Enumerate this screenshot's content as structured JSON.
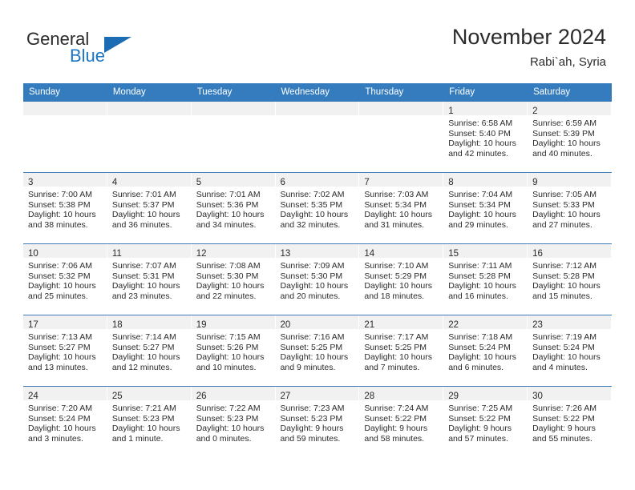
{
  "brand": {
    "name_top": "General",
    "name_bottom": "Blue",
    "accent_color": "#1b6cb3"
  },
  "header": {
    "title": "November 2024",
    "subtitle": "Rabi`ah, Syria"
  },
  "theme": {
    "header_bg": "#357cbf",
    "daynum_bg": "#f1f1f1",
    "row_border": "#3f7cb8"
  },
  "weekdays": [
    "Sunday",
    "Monday",
    "Tuesday",
    "Wednesday",
    "Thursday",
    "Friday",
    "Saturday"
  ],
  "weeks": [
    [
      {
        "day": "",
        "lines": []
      },
      {
        "day": "",
        "lines": []
      },
      {
        "day": "",
        "lines": []
      },
      {
        "day": "",
        "lines": []
      },
      {
        "day": "",
        "lines": []
      },
      {
        "day": "1",
        "lines": [
          "Sunrise: 6:58 AM",
          "Sunset: 5:40 PM",
          "Daylight: 10 hours",
          "and 42 minutes."
        ]
      },
      {
        "day": "2",
        "lines": [
          "Sunrise: 6:59 AM",
          "Sunset: 5:39 PM",
          "Daylight: 10 hours",
          "and 40 minutes."
        ]
      }
    ],
    [
      {
        "day": "3",
        "lines": [
          "Sunrise: 7:00 AM",
          "Sunset: 5:38 PM",
          "Daylight: 10 hours",
          "and 38 minutes."
        ]
      },
      {
        "day": "4",
        "lines": [
          "Sunrise: 7:01 AM",
          "Sunset: 5:37 PM",
          "Daylight: 10 hours",
          "and 36 minutes."
        ]
      },
      {
        "day": "5",
        "lines": [
          "Sunrise: 7:01 AM",
          "Sunset: 5:36 PM",
          "Daylight: 10 hours",
          "and 34 minutes."
        ]
      },
      {
        "day": "6",
        "lines": [
          "Sunrise: 7:02 AM",
          "Sunset: 5:35 PM",
          "Daylight: 10 hours",
          "and 32 minutes."
        ]
      },
      {
        "day": "7",
        "lines": [
          "Sunrise: 7:03 AM",
          "Sunset: 5:34 PM",
          "Daylight: 10 hours",
          "and 31 minutes."
        ]
      },
      {
        "day": "8",
        "lines": [
          "Sunrise: 7:04 AM",
          "Sunset: 5:34 PM",
          "Daylight: 10 hours",
          "and 29 minutes."
        ]
      },
      {
        "day": "9",
        "lines": [
          "Sunrise: 7:05 AM",
          "Sunset: 5:33 PM",
          "Daylight: 10 hours",
          "and 27 minutes."
        ]
      }
    ],
    [
      {
        "day": "10",
        "lines": [
          "Sunrise: 7:06 AM",
          "Sunset: 5:32 PM",
          "Daylight: 10 hours",
          "and 25 minutes."
        ]
      },
      {
        "day": "11",
        "lines": [
          "Sunrise: 7:07 AM",
          "Sunset: 5:31 PM",
          "Daylight: 10 hours",
          "and 23 minutes."
        ]
      },
      {
        "day": "12",
        "lines": [
          "Sunrise: 7:08 AM",
          "Sunset: 5:30 PM",
          "Daylight: 10 hours",
          "and 22 minutes."
        ]
      },
      {
        "day": "13",
        "lines": [
          "Sunrise: 7:09 AM",
          "Sunset: 5:30 PM",
          "Daylight: 10 hours",
          "and 20 minutes."
        ]
      },
      {
        "day": "14",
        "lines": [
          "Sunrise: 7:10 AM",
          "Sunset: 5:29 PM",
          "Daylight: 10 hours",
          "and 18 minutes."
        ]
      },
      {
        "day": "15",
        "lines": [
          "Sunrise: 7:11 AM",
          "Sunset: 5:28 PM",
          "Daylight: 10 hours",
          "and 16 minutes."
        ]
      },
      {
        "day": "16",
        "lines": [
          "Sunrise: 7:12 AM",
          "Sunset: 5:28 PM",
          "Daylight: 10 hours",
          "and 15 minutes."
        ]
      }
    ],
    [
      {
        "day": "17",
        "lines": [
          "Sunrise: 7:13 AM",
          "Sunset: 5:27 PM",
          "Daylight: 10 hours",
          "and 13 minutes."
        ]
      },
      {
        "day": "18",
        "lines": [
          "Sunrise: 7:14 AM",
          "Sunset: 5:27 PM",
          "Daylight: 10 hours",
          "and 12 minutes."
        ]
      },
      {
        "day": "19",
        "lines": [
          "Sunrise: 7:15 AM",
          "Sunset: 5:26 PM",
          "Daylight: 10 hours",
          "and 10 minutes."
        ]
      },
      {
        "day": "20",
        "lines": [
          "Sunrise: 7:16 AM",
          "Sunset: 5:25 PM",
          "Daylight: 10 hours",
          "and 9 minutes."
        ]
      },
      {
        "day": "21",
        "lines": [
          "Sunrise: 7:17 AM",
          "Sunset: 5:25 PM",
          "Daylight: 10 hours",
          "and 7 minutes."
        ]
      },
      {
        "day": "22",
        "lines": [
          "Sunrise: 7:18 AM",
          "Sunset: 5:24 PM",
          "Daylight: 10 hours",
          "and 6 minutes."
        ]
      },
      {
        "day": "23",
        "lines": [
          "Sunrise: 7:19 AM",
          "Sunset: 5:24 PM",
          "Daylight: 10 hours",
          "and 4 minutes."
        ]
      }
    ],
    [
      {
        "day": "24",
        "lines": [
          "Sunrise: 7:20 AM",
          "Sunset: 5:24 PM",
          "Daylight: 10 hours",
          "and 3 minutes."
        ]
      },
      {
        "day": "25",
        "lines": [
          "Sunrise: 7:21 AM",
          "Sunset: 5:23 PM",
          "Daylight: 10 hours",
          "and 1 minute."
        ]
      },
      {
        "day": "26",
        "lines": [
          "Sunrise: 7:22 AM",
          "Sunset: 5:23 PM",
          "Daylight: 10 hours",
          "and 0 minutes."
        ]
      },
      {
        "day": "27",
        "lines": [
          "Sunrise: 7:23 AM",
          "Sunset: 5:23 PM",
          "Daylight: 9 hours",
          "and 59 minutes."
        ]
      },
      {
        "day": "28",
        "lines": [
          "Sunrise: 7:24 AM",
          "Sunset: 5:22 PM",
          "Daylight: 9 hours",
          "and 58 minutes."
        ]
      },
      {
        "day": "29",
        "lines": [
          "Sunrise: 7:25 AM",
          "Sunset: 5:22 PM",
          "Daylight: 9 hours",
          "and 57 minutes."
        ]
      },
      {
        "day": "30",
        "lines": [
          "Sunrise: 7:26 AM",
          "Sunset: 5:22 PM",
          "Daylight: 9 hours",
          "and 55 minutes."
        ]
      }
    ]
  ]
}
